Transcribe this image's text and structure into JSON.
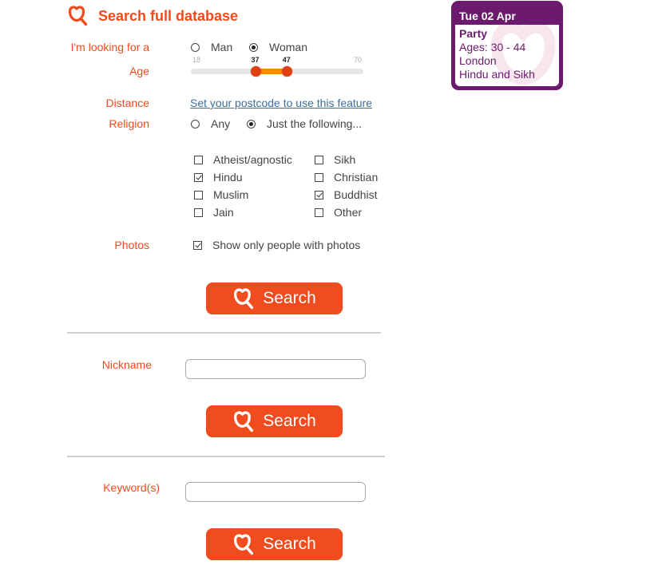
{
  "header": {
    "title": "Search full database",
    "icon": "heart-search-icon"
  },
  "brand_color": "#ef4b1d",
  "looking_for": {
    "label": "I'm looking for a",
    "options": [
      {
        "label": "Man",
        "selected": false
      },
      {
        "label": "Woman",
        "selected": true
      }
    ]
  },
  "age": {
    "label": "Age",
    "min": 18,
    "max": 70,
    "low": 37,
    "high": 47,
    "min_label": "18",
    "max_label": "70",
    "low_label": "37",
    "high_label": "47"
  },
  "distance": {
    "label": "Distance",
    "link": "Set your postcode to use this feature"
  },
  "religion": {
    "label": "Religion",
    "options": [
      {
        "label": "Any",
        "selected": false
      },
      {
        "label": "Just the following...",
        "selected": true
      }
    ],
    "choices_left": [
      {
        "label": "Atheist/agnostic",
        "checked": false
      },
      {
        "label": "Hindu",
        "checked": true
      },
      {
        "label": "Muslim",
        "checked": false
      },
      {
        "label": "Jain",
        "checked": false
      }
    ],
    "choices_right": [
      {
        "label": "Sikh",
        "checked": false
      },
      {
        "label": "Christian",
        "checked": false
      },
      {
        "label": "Buddhist",
        "checked": true
      },
      {
        "label": "Other",
        "checked": false
      }
    ]
  },
  "photos": {
    "label": "Photos",
    "option": "Show only people with photos",
    "checked": true
  },
  "search_button_label": "Search",
  "nickname": {
    "label": "Nickname",
    "value": "",
    "placeholder": ""
  },
  "keywords": {
    "label": "Keyword(s)",
    "value": "",
    "placeholder": ""
  },
  "event": {
    "date": "Tue 02 Apr",
    "name": "Party",
    "ages": "Ages: 30 - 44",
    "location": "London",
    "religion": "Hindu and Sikh",
    "color": "#6b1a6e"
  }
}
